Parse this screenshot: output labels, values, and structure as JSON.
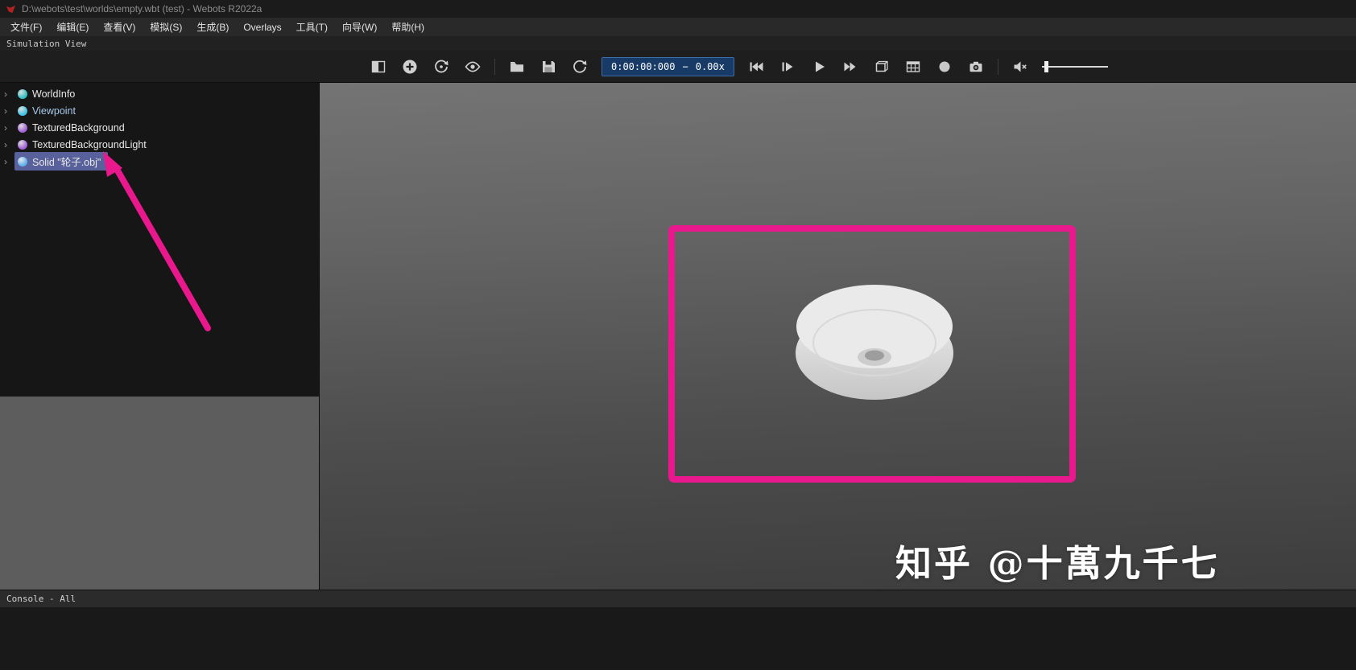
{
  "window": {
    "title": "D:\\webots\\test\\worlds\\empty.wbt (test) - Webots R2022a"
  },
  "menu": {
    "items": [
      "文件(F)",
      "编辑(E)",
      "查看(V)",
      "模拟(S)",
      "生成(B)",
      "Overlays",
      "工具(T)",
      "向导(W)",
      "帮助(H)"
    ]
  },
  "view_tab": "Simulation View",
  "toolbar": {
    "time": "0:00:00:000",
    "separator": "−",
    "speed": "0.00x",
    "icons": [
      "restore-layout-icon",
      "add-node-icon",
      "reset-simulation-icon",
      "show-rendering-icon",
      "open-world-icon",
      "save-world-icon",
      "reload-world-icon",
      "rewind-icon",
      "step-icon",
      "play-icon",
      "fast-forward-icon",
      "perspective-view-icon",
      "grid-overlay-icon",
      "record-icon",
      "screenshot-icon",
      "sound-mute-icon",
      "volume-slider"
    ]
  },
  "tree": {
    "items": [
      {
        "label": "WorldInfo",
        "color": "#2fbfc4",
        "selected": false
      },
      {
        "label": "Viewpoint",
        "color": "#3cc3e8",
        "text_color": "#a9c9ec",
        "selected": false
      },
      {
        "label": "TexturedBackground",
        "color": "#a35fd6",
        "selected": false
      },
      {
        "label": "TexturedBackgroundLight",
        "color": "#a35fd6",
        "selected": false
      },
      {
        "label": "Solid \"轮子.obj\"",
        "color": "#5fb2e8",
        "selected": true
      }
    ]
  },
  "console": {
    "label": "Console - All"
  },
  "watermark": "知乎 @十萬九千七",
  "colors": {
    "annotation_pink": "#e9188c",
    "selection_blue": "#58619b",
    "timebox_blue": "#173a66"
  }
}
